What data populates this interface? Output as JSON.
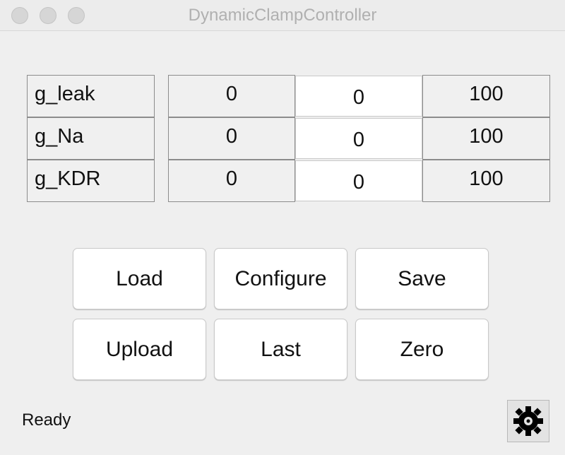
{
  "window": {
    "title": "DynamicClampController"
  },
  "parameters": [
    {
      "name": "g_leak",
      "min": "0",
      "value": "0",
      "max": "100"
    },
    {
      "name": "g_Na",
      "min": "0",
      "value": "0",
      "max": "100"
    },
    {
      "name": "g_KDR",
      "min": "0",
      "value": "0",
      "max": "100"
    }
  ],
  "buttons": {
    "load": "Load",
    "configure": "Configure",
    "save": "Save",
    "upload": "Upload",
    "last": "Last",
    "zero": "Zero"
  },
  "status": {
    "text": "Ready"
  },
  "icons": {
    "settings": "gear-icon"
  }
}
